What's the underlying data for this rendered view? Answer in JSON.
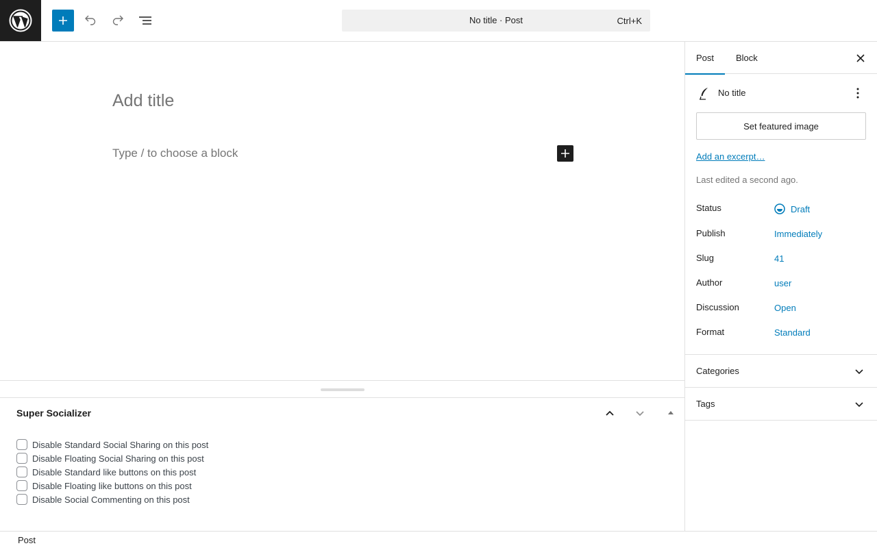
{
  "header": {
    "logo_icon": "wordpress-logo-icon",
    "add_block_icon": "plus-icon",
    "undo_icon": "undo-icon",
    "redo_icon": "redo-icon",
    "list_view_icon": "list-view-icon",
    "command_bar": {
      "title": "No title · Post",
      "shortcut": "Ctrl+K"
    }
  },
  "canvas": {
    "title_placeholder": "Add title",
    "block_placeholder": "Type / to choose a block"
  },
  "metabox": {
    "title": "Super Socializer",
    "options": [
      "Disable Standard Social Sharing on this post",
      "Disable Floating Social Sharing on this post",
      "Disable Standard like buttons on this post",
      "Disable Floating like buttons on this post",
      "Disable Social Commenting on this post"
    ]
  },
  "footer": {
    "breadcrumb": "Post"
  },
  "sidebar": {
    "tabs": [
      "Post",
      "Block"
    ],
    "active_tab": "Post",
    "post_title": "No title",
    "featured_image_label": "Set featured image",
    "excerpt_link": "Add an excerpt…",
    "last_edited": "Last edited a second ago.",
    "meta": [
      {
        "label": "Status",
        "value": "Draft"
      },
      {
        "label": "Publish",
        "value": "Immediately"
      },
      {
        "label": "Slug",
        "value": "41"
      },
      {
        "label": "Author",
        "value": "user"
      },
      {
        "label": "Discussion",
        "value": "Open"
      },
      {
        "label": "Format",
        "value": "Standard"
      }
    ],
    "panels": [
      "Categories",
      "Tags"
    ]
  },
  "colors": {
    "accent": "#007cba",
    "dark": "#1e1e1e",
    "muted": "#757575"
  }
}
